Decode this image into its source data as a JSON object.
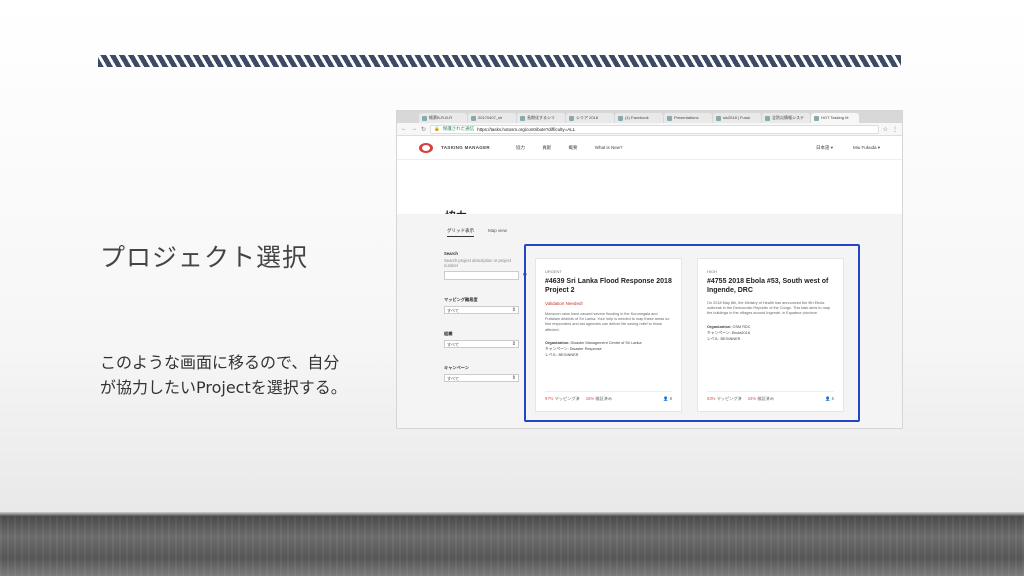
{
  "slide": {
    "title": "プロジェクト選択",
    "body_line1": "このような画面に移るので、自分",
    "body_line2": "が協力したいProjectを選択する。"
  },
  "browser": {
    "tabs": [
      "帳票B-R-B-R",
      "20170407_sh",
      "長期化するシリ",
      "シリア 2018",
      "(1) Facebook",
      "Presentations",
      "sis2018 | Furuk",
      "全防災情報システ",
      "HOT Tasking M"
    ],
    "security_label": "保護された通信",
    "url": "https://tasks.hotosm.org/contribute?difficulty=ALL"
  },
  "tasking_manager": {
    "brand": "TASKING MANAGER",
    "nav": [
      "協力",
      "貢献",
      "概要",
      "What is New?"
    ],
    "language": "日本語",
    "user": "Miu Fukuda",
    "page_title": "協力",
    "view_tabs": [
      "グリッド表示",
      "Map view"
    ],
    "sidebar": {
      "search_label": "Search",
      "search_hint": "Search project description or project number",
      "mapping_difficulty_label": "マッピング難易度",
      "mapping_difficulty_value": "すべて",
      "organization_label": "組織",
      "organization_value": "すべて",
      "campaign_label": "キャンペーン",
      "campaign_value": "すべて"
    },
    "cards": [
      {
        "priority": "URGENT",
        "title": "#4639 Sri Lanka Flood Response 2018 Project 2",
        "warning": "Validation Needed!",
        "description": "Monsoon rains have caused severe flooding in the Kurunegala and Puttalam districts of Sri Lanka. Your help is needed to map these areas so first responders and aid agencies can deliver life saving relief to those affected.",
        "org_label": "Organization:",
        "org_value": "Disaster Management Centre of Sri Lanka",
        "campaign_label": "キャンペーン:",
        "campaign_value": "Disaster Response",
        "level_label": "レベル:",
        "level_value": "BEGINNER",
        "mapped_pct": "97%",
        "mapped_label": "マッピング済",
        "validated_pct": "18%",
        "validated_label": "検証済み",
        "contributors": "8"
      },
      {
        "priority": "HIGH",
        "title": "#4755 2018 Ebola #53, South west of Ingende, DRC",
        "warning": "",
        "description": "On 2018 May 8th, the Ministry of Health has announced the 9th Ebola outbreak in the Democratic Republic of the Congo. This task aims to map the buildings in the villages around Ingende, in Equateur province.",
        "org_label": "Organization:",
        "org_value": "OSM RDC",
        "campaign_label": "キャンペーン:",
        "campaign_value": "Ebola2018",
        "level_label": "レベル:",
        "level_value": "BEGINNER",
        "mapped_pct": "93%",
        "mapped_label": "マッピング済",
        "validated_pct": "24%",
        "validated_label": "検証済み",
        "contributors": "5"
      }
    ]
  }
}
